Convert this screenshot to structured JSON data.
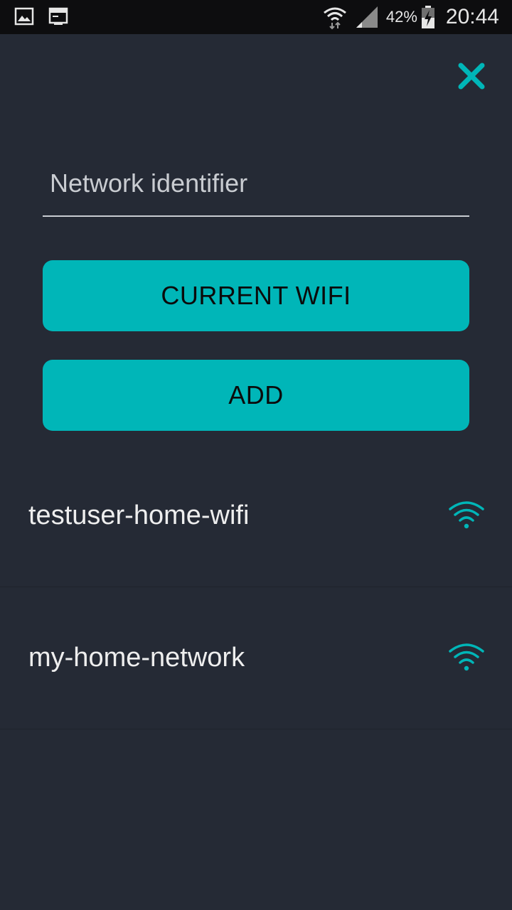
{
  "status_bar": {
    "left_icons": [
      "gallery-icon",
      "terminal-icon"
    ],
    "right_icons": [
      "wifi-data-icon",
      "cell-signal-icon",
      "battery-charging-icon"
    ],
    "battery_percent": "42%",
    "time": "20:44"
  },
  "close_icon": "close-icon",
  "network_input": {
    "placeholder": "Network identifier",
    "value": ""
  },
  "buttons": {
    "current_wifi": "CURRENT WIFI",
    "add": "ADD"
  },
  "networks": [
    {
      "name": "testuser-home-wifi",
      "icon": "wifi-icon"
    },
    {
      "name": "my-home-network",
      "icon": "wifi-icon"
    }
  ],
  "colors": {
    "background": "#252a35",
    "status_bar": "#0d0d0f",
    "accent": "#00b6b8",
    "text": "#eeeeee"
  }
}
